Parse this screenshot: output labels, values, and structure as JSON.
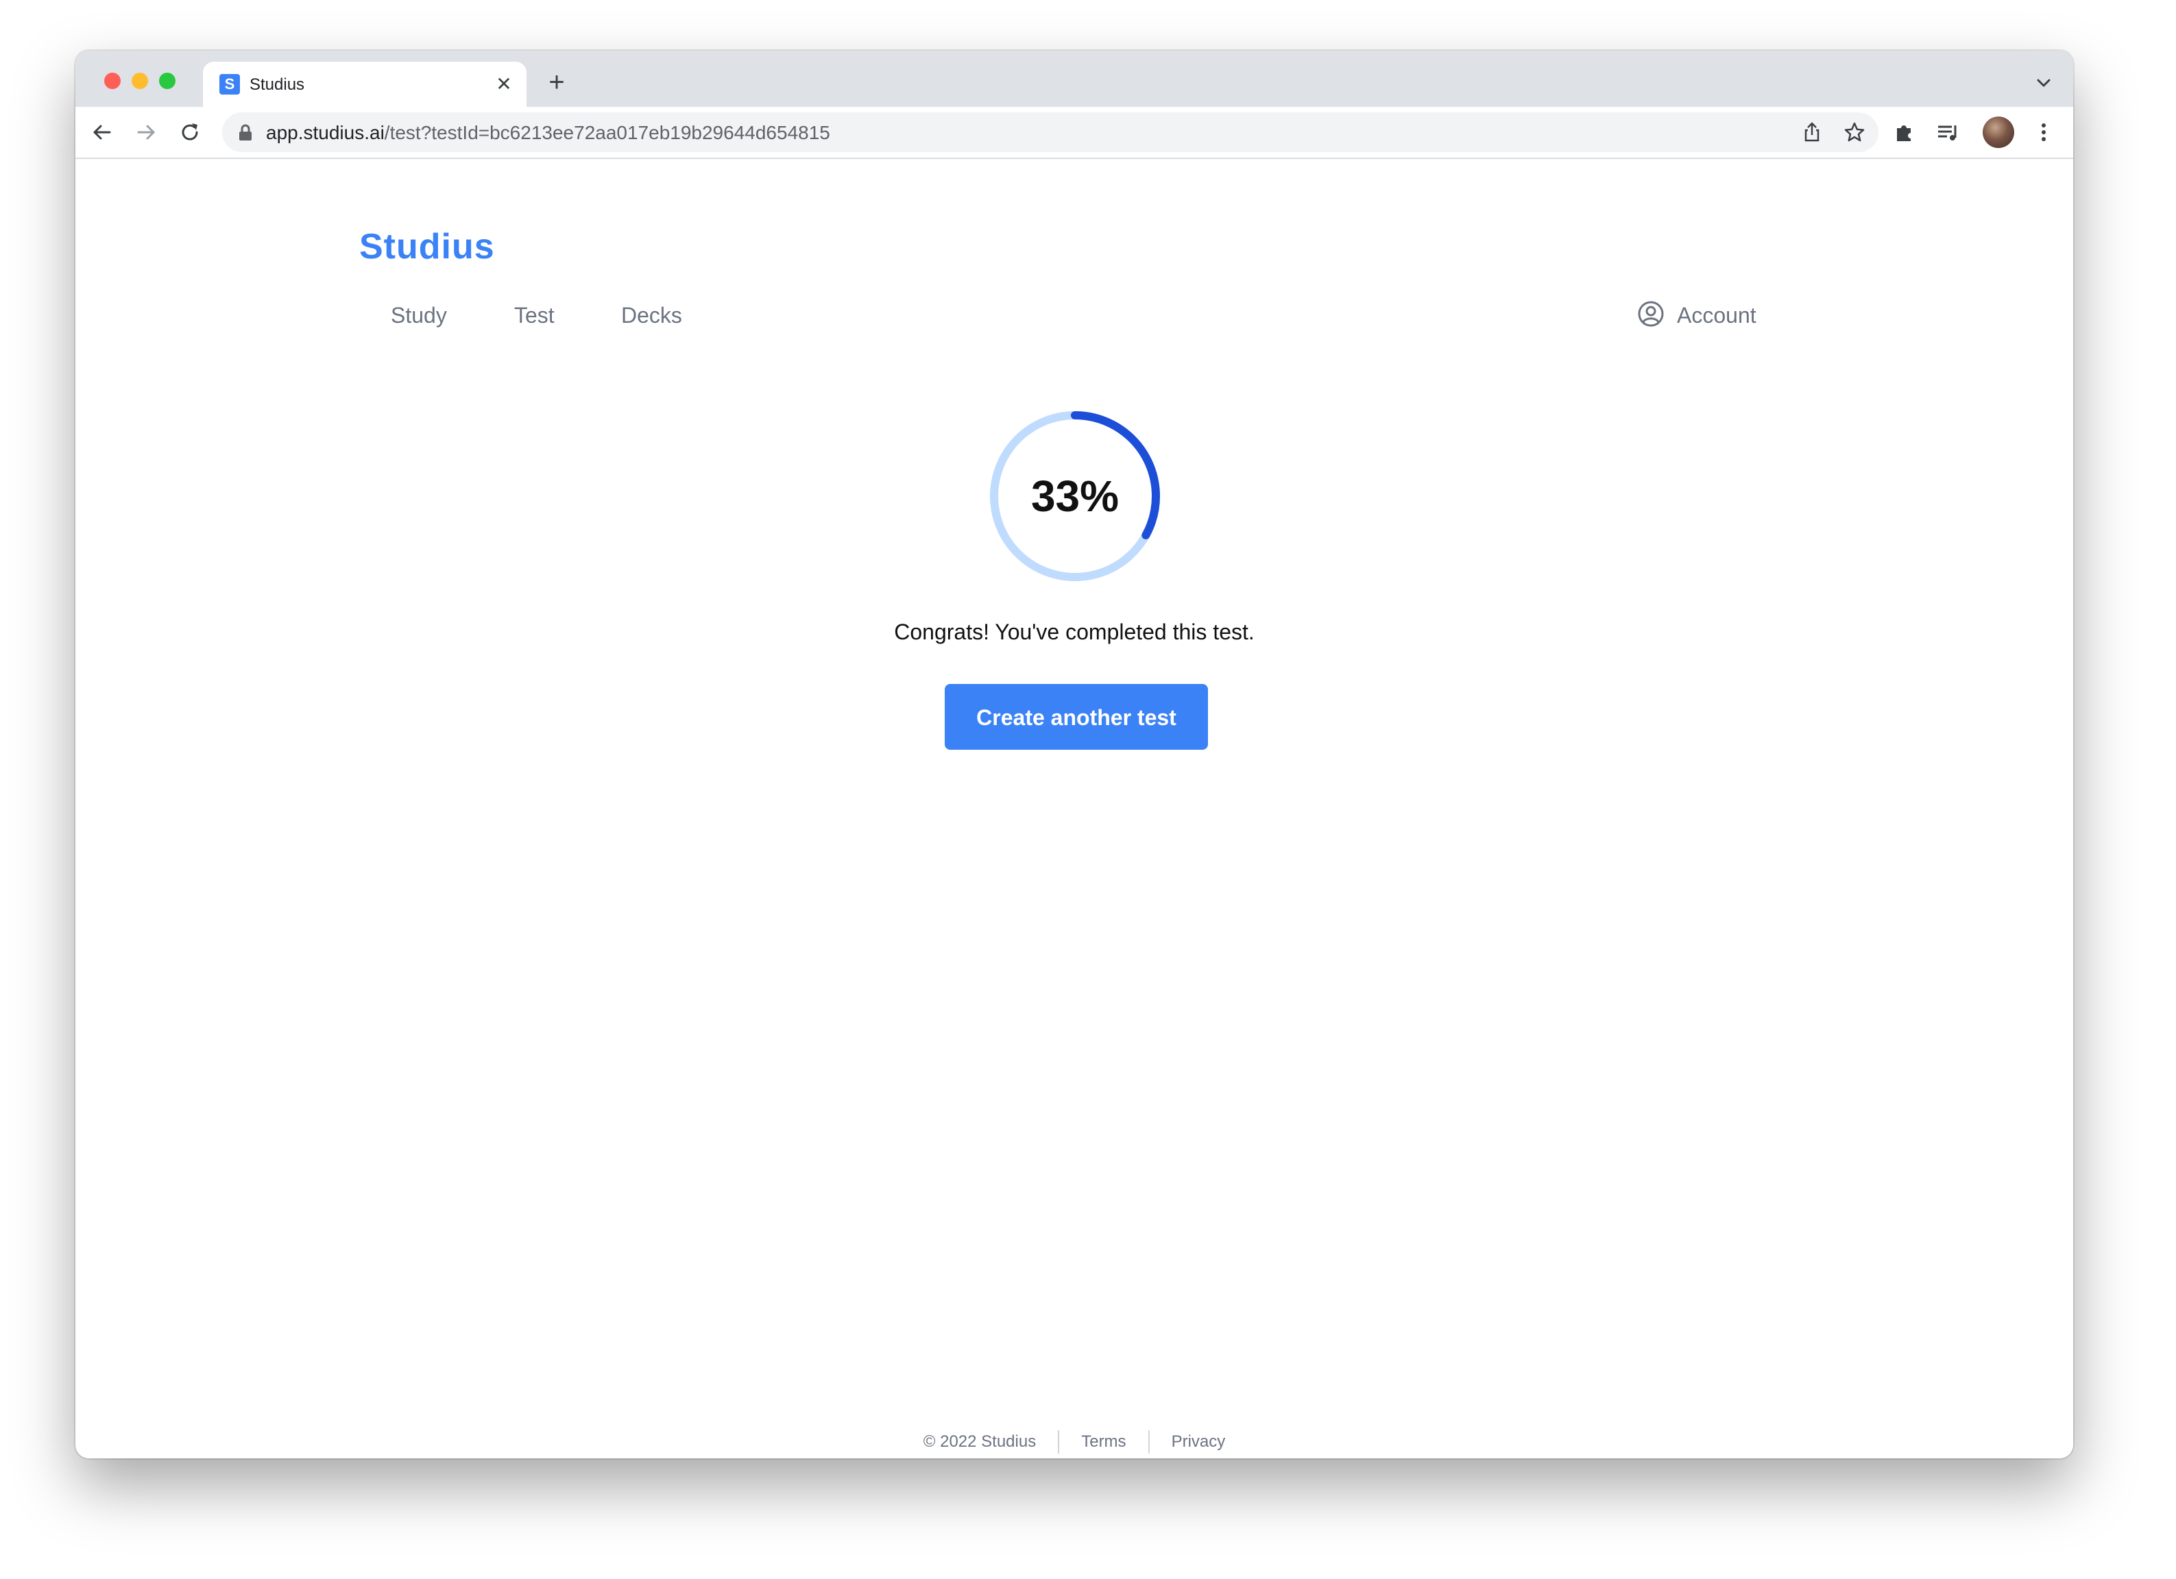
{
  "browser": {
    "tab_title": "Studius",
    "tab_favicon_letter": "S",
    "url_host": "app.studius.ai",
    "url_path": "/test?testId=bc6213ee72aa017eb19b29644d654815"
  },
  "header": {
    "logo": "Studius",
    "nav": {
      "study": "Study",
      "test": "Test",
      "decks": "Decks"
    },
    "account": "Account"
  },
  "result": {
    "percent": 33,
    "percent_label": "33%",
    "message": "Congrats! You've completed this test.",
    "button_label": "Create another test"
  },
  "footer": {
    "copyright": "© 2022 Studius",
    "terms": "Terms",
    "privacy": "Privacy"
  },
  "colors": {
    "accent": "#3b82f6",
    "progress_fill": "#1d4ed8",
    "progress_track": "#bfdbfe"
  }
}
